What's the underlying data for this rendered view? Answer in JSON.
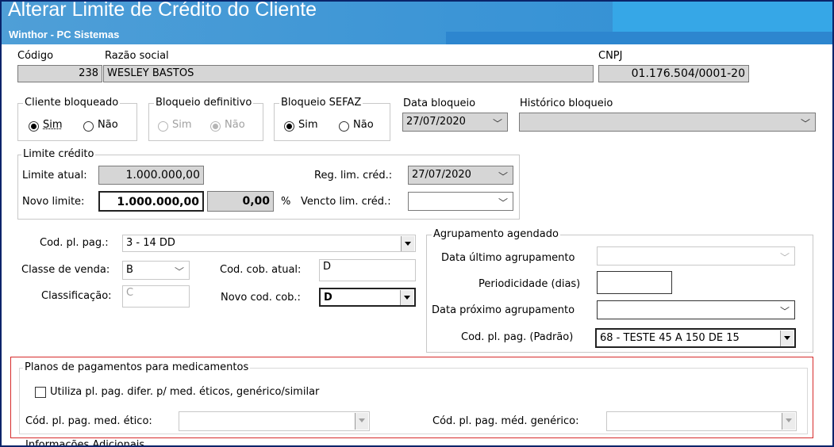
{
  "window": {
    "title": "Alterar Limite de Crédito do Cliente",
    "subtitle": "Winthor - PC Sistemas"
  },
  "cliente": {
    "codigo_label": "Código",
    "codigo": "238",
    "razao_label": "Razão social",
    "razao": "WESLEY BASTOS",
    "cnpj_label": "CNPJ",
    "cnpj": "01.176.504/0001-20"
  },
  "bloqueio": {
    "cliente_bloqueado": {
      "legend": "Cliente bloqueado",
      "sim": "Sim",
      "nao": "Não",
      "selected": "sim"
    },
    "bloqueio_definitivo": {
      "legend": "Bloqueio definitivo",
      "sim": "Sim",
      "nao": "Não",
      "selected": "nao"
    },
    "bloqueio_sefaz": {
      "legend": "Bloqueio SEFAZ",
      "sim": "Sim",
      "nao": "Não",
      "selected": "sim"
    },
    "data_label": "Data bloqueio",
    "data": "27/07/2020",
    "historico_label": "Histórico bloqueio",
    "historico": ""
  },
  "limite": {
    "legend": "Limite crédito",
    "atual_label": "Limite atual:",
    "atual": "1.000.000,00",
    "novo_label": "Novo limite:",
    "novo": "1.000.000,00",
    "percent": "0,00",
    "percent_sign": "%",
    "reg_label": "Reg. lim. créd.:",
    "reg": "27/07/2020",
    "vencto_label": "Vencto lim. créd.:",
    "vencto": ""
  },
  "pagamento": {
    "cod_pl_label": "Cod. pl. pag.:",
    "cod_pl": "3 - 14 DD",
    "classe_label": "Classe de venda:",
    "classe": "B",
    "classificacao_label": "Classificação:",
    "classificacao": "C",
    "cob_atual_label": "Cod. cob. atual:",
    "cob_atual": "D",
    "novo_cob_label": "Novo cod. cob.:",
    "novo_cob": "D"
  },
  "agrupamento": {
    "legend": "Agrupamento agendado",
    "ultimo_label": "Data último agrupamento",
    "ultimo": "",
    "periodicidade_label": "Periodicidade (dias)",
    "periodicidade": "",
    "proximo_label": "Data próximo agrupamento",
    "proximo": "",
    "padrao_label": "Cod. pl. pag. (Padrão)",
    "padrao": "68 - TESTE 45 A 150 DE 15"
  },
  "medicamentos": {
    "legend": "Planos de pagamentos para medicamentos",
    "checkbox_label": "Utiliza pl. pag. difer. p/ med. éticos, genérico/similar",
    "etico_label": "Cód. pl. pag. med. ético:",
    "etico": "",
    "generico_label": "Cód. pl. pag. méd. genérico:",
    "generico": ""
  },
  "info_adicional_label": "Informações Adicionais"
}
